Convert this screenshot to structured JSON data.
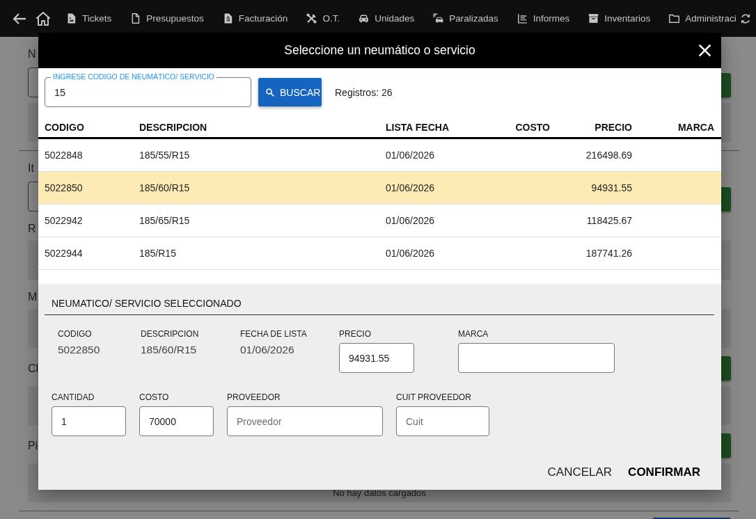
{
  "nav": {
    "items": [
      {
        "label": "Tickets"
      },
      {
        "label": "Presupuestos"
      },
      {
        "label": "Facturación"
      },
      {
        "label": "O.T."
      },
      {
        "label": "Unidades"
      },
      {
        "label": "Paralizadas"
      },
      {
        "label": "Informes"
      },
      {
        "label": "Inventarios"
      },
      {
        "label": "Administraci"
      }
    ]
  },
  "page": {
    "rows": [
      {
        "kind": "label",
        "text": "N",
        "action": false
      },
      {
        "kind": "input",
        "action": true
      },
      {
        "kind": "panel"
      },
      {
        "kind": "rule"
      },
      {
        "kind": "label",
        "text": "It",
        "action": false
      },
      {
        "kind": "input",
        "action": true
      },
      {
        "kind": "label",
        "text": "R",
        "action": false
      },
      {
        "kind": "panel"
      },
      {
        "kind": "label",
        "text": "M",
        "action": false
      },
      {
        "kind": "panel"
      },
      {
        "kind": "label",
        "text": "Cl",
        "action": true
      },
      {
        "kind": "panel"
      },
      {
        "kind": "label",
        "text": "Pi",
        "action": true
      },
      {
        "kind": "panel",
        "text": "No hay datos cargados"
      },
      {
        "kind": "rule"
      },
      {
        "kind": "button"
      }
    ]
  },
  "dialog": {
    "title": "Seleccione un neumático o servicio",
    "search": {
      "label": "INGRESE CODIGO DE NEUMÁTICO/ SERVICIO",
      "value": "15"
    },
    "search_button": "BUSCAR",
    "record_count": "Registros: 26",
    "table": {
      "columns": [
        "CODIGO",
        "DESCRIPCION",
        "LISTA FECHA",
        "COSTO",
        "PRECIO",
        "MARCA"
      ],
      "rows": [
        {
          "code": "5022848",
          "description": "185/55/R15",
          "list_date": "01/06/2026",
          "price": "216498.69",
          "selected": false
        },
        {
          "code": "5022850",
          "description": "185/60/R15",
          "list_date": "01/06/2026",
          "price": "94931.55",
          "selected": true
        },
        {
          "code": "5022942",
          "description": "185/65/R15",
          "list_date": "01/06/2026",
          "price": "118425.67",
          "selected": false
        },
        {
          "code": "5022944",
          "description": "185/R15",
          "list_date": "01/06/2026",
          "price": "187741.26",
          "selected": false
        }
      ]
    },
    "selection": {
      "title": "NEUMATICO/ SERVICIO SELECCIONADO",
      "rows": [
        {
          "items": [
            {
              "kind": "text",
              "label": "CODIGO",
              "value": "5022850"
            },
            {
              "kind": "text",
              "label": "DESCRIPCION",
              "value": "185/60/R15"
            },
            {
              "kind": "text",
              "label": "FECHA DE LISTA",
              "value": "01/06/2026"
            },
            {
              "kind": "input",
              "label": "PRECIO",
              "value": "94931.55"
            },
            {
              "kind": "input",
              "label": "MARCA"
            }
          ]
        },
        {
          "items": [
            {
              "kind": "input",
              "label": "CANTIDAD",
              "value": "1"
            },
            {
              "kind": "input",
              "label": "COSTO",
              "value": "70000"
            },
            {
              "kind": "input",
              "label": "PROVEEDOR",
              "placeholder": "Proveedor"
            },
            {
              "kind": "input",
              "label": "CUIT PROVEEDOR",
              "placeholder": "Cuit"
            }
          ]
        }
      ]
    },
    "buttons": [
      {
        "label": "CANCELAR",
        "kind": "secondary"
      },
      {
        "label": "CONFIRMAR",
        "kind": "primary"
      }
    ]
  }
}
